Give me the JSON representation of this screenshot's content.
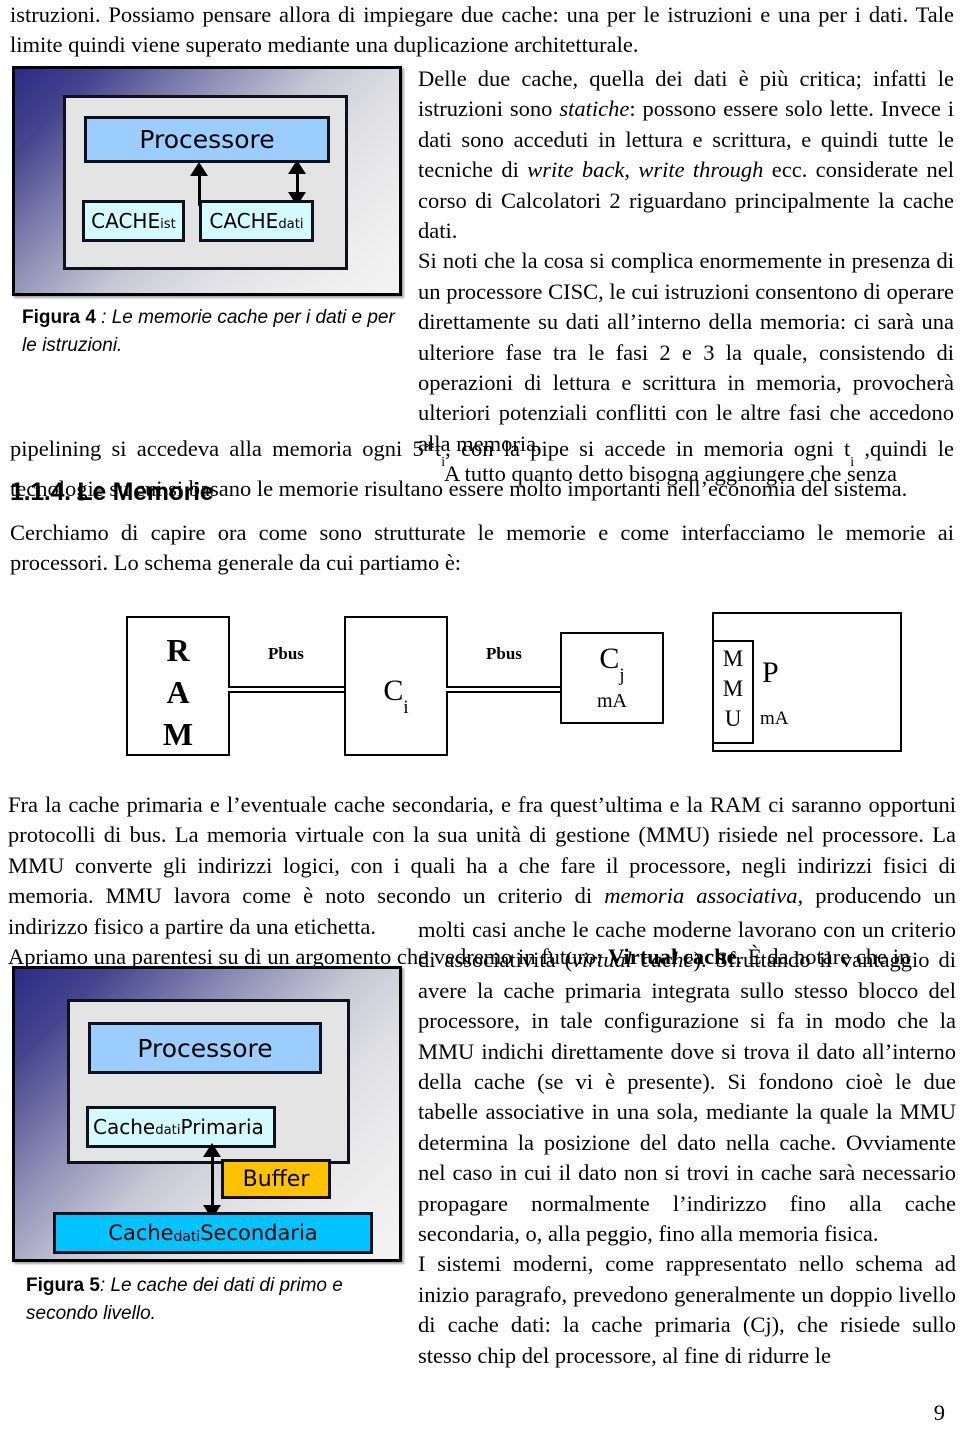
{
  "document": {
    "page_number": "9"
  },
  "intro": {
    "paragraph": "istruzioni. Possiamo pensare allora di impiegare due cache: una per le istruzioni e una per i dati. Tale limite quindi viene superato mediante una duplicazione architetturale."
  },
  "column_right_1": {
    "p1_a": "Delle due cache, quella dei dati è più critica; infatti le istruzioni sono ",
    "p1_i1": "statiche",
    "p1_b": ": possono essere solo lette. Invece i dati sono acceduti in lettura e scrittura, e quindi tutte le tecniche di ",
    "p1_i2": "write back",
    "p1_c": ", ",
    "p1_i3": "write through",
    "p1_d": " ecc. considerate nel corso di Calcolatori 2 riguardano principalmente la cache dati.",
    "p2": "Si noti che la cosa si complica enormemente in presenza di un processore CISC, le cui istruzioni consentono di operare direttamente su dati all’interno della memoria: ci sarà una ulteriore fase tra le fasi 2 e 3 la quale, consistendo di operazioni di lettura e scrittura in memoria, provocherà ulteriori potenziali conflitti con le altre fasi che accedono alla memoria.",
    "p3": "A tutto quanto detto bisogna aggiungere che senza"
  },
  "after_fig4": {
    "text_a": "pipelining si accedeva alla memoria ogni 5*t",
    "sub_1": "i",
    "text_b": ", con la pipe si accede in memoria ogni t",
    "sub_2": "i",
    "text_c": " ,quindi le tecnologie su cui si basano le memorie risultano essere molto importanti nell’economia del sistema."
  },
  "section": {
    "heading": "1.1.4. Le Memorie",
    "paragraph": "Cerchiamo di capire ora come sono strutturate le memorie e come interfacciamo le memorie ai processori. Lo schema generale da cui partiamo è:"
  },
  "schema": {
    "ram": {
      "line1": "R",
      "line2": "A",
      "line3": "M"
    },
    "bus1_label": "Pbus",
    "bus2_label": "Pbus",
    "ci": {
      "label": "C",
      "sub": "i"
    },
    "cj": {
      "label": "C",
      "sub": "j",
      "note": "mA"
    },
    "mmu": {
      "line1": "M",
      "line2": "M",
      "line3": "U"
    },
    "processor": {
      "label": "P",
      "note": "mA"
    }
  },
  "after_schema": {
    "text_a": "Fra la cache primaria e l’eventuale cache secondaria, e fra quest’ultima e la RAM ci saranno opportuni protocolli di bus. La memoria virtuale con la sua unità di gestione (MMU) risiede nel processore. La MMU converte gli indirizzi logici, con i quali ha a che fare il processore, negli indirizzi fisici di memoria. MMU lavora come è noto secondo un criterio di ",
    "italic_1": "memoria associativa",
    "text_b": ", producendo un indirizzo fisico a partire da una etichetta.",
    "text_c": "Apriamo una parentesi su di un argomento che vedremo in futuro: ",
    "bold_1": "Virtual cache",
    "text_d": ". È da notare che in"
  },
  "column_right_2": {
    "p1_a": "molti casi anche le cache moderne lavorano con un criterio di associatività (",
    "p1_i1": "virtual cache",
    "p1_b": "). Sfruttando il vantaggio di avere la cache primaria integrata sullo stesso blocco del processore, in tale configurazione si fa in modo che la MMU indichi direttamente dove si trova il dato all’interno della cache (se vi è presente). Si fondono cioè le due tabelle associative in una sola, mediante la quale la MMU determina la posizione del dato nella cache. Ovviamente nel caso in cui il dato non si trovi in cache sarà necessario propagare normalmente l’indirizzo fino alla cache secondaria, o, alla peggio, fino alla memoria fisica.",
    "p2": "I sistemi moderni, come rappresentato nello schema ad inizio paragrafo, prevedono generalmente un doppio livello di cache dati: la cache primaria (Cj), che risiede sullo stesso chip del processore, al fine di ridurre le"
  },
  "figure4": {
    "processor_label": "Processore",
    "cache_ist": {
      "base": "CACHE",
      "sub": "ist"
    },
    "cache_dati": {
      "base": "CACHE",
      "sub": "dati"
    },
    "caption_bold": "Figura 4",
    "caption_rest": " : Le memorie cache per i dati e per le istruzioni.",
    "colors": {
      "processor_fill": "#9ccdff",
      "cache_fill": "#d3fbff",
      "chip_fill": "#e4e4e4",
      "frame_gradient_start": "#2b2b86",
      "frame_gradient_end": "#f3f3f3"
    }
  },
  "figure5": {
    "processor_label": "Processore",
    "cache_primaria": {
      "base": "Cache",
      "sub": "dati",
      "rest": " Primaria"
    },
    "buffer_label": "Buffer",
    "cache_secondaria": {
      "base": "Cache",
      "sub": "dati",
      "rest": " Secondaria"
    },
    "caption_bold": "Figura 5",
    "caption_rest": ": Le cache dei dati di primo e secondo livello.",
    "colors": {
      "processor_fill": "#9ccdff",
      "cache_primaria_fill": "#d3fbff",
      "buffer_fill": "#ffc200",
      "cache_secondaria_fill": "#00c3ff"
    }
  }
}
